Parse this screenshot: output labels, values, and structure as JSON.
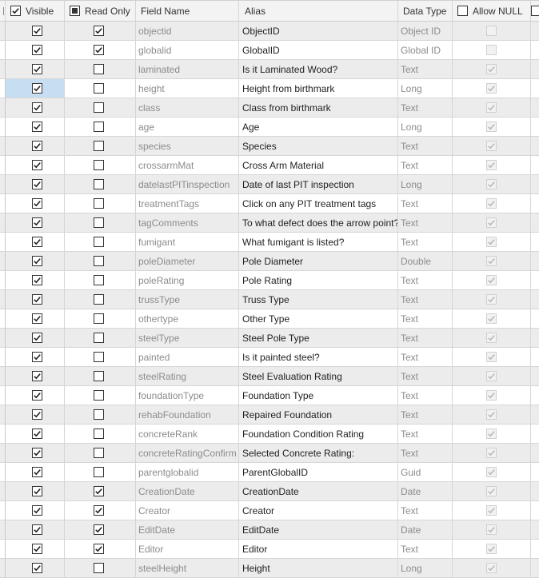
{
  "header": {
    "visible_label": "Visible",
    "readonly_label": "Read Only",
    "fieldname_label": "Field Name",
    "alias_label": "Alias",
    "datatype_label": "Data Type",
    "allownull_label": "Allow NULL"
  },
  "rows": [
    {
      "name": "objectid",
      "alias": "ObjectID",
      "type": "Object ID",
      "visible": true,
      "readonly": true,
      "allownull": false
    },
    {
      "name": "globalid",
      "alias": "GlobalID",
      "type": "Global ID",
      "visible": true,
      "readonly": true,
      "allownull": false
    },
    {
      "name": "laminated",
      "alias": "Is it Laminated Wood?",
      "type": "Text",
      "visible": true,
      "readonly": false,
      "allownull": true
    },
    {
      "name": "height",
      "alias": "Height from birthmark",
      "type": "Long",
      "visible": true,
      "readonly": false,
      "allownull": true
    },
    {
      "name": "class",
      "alias": "Class from birthmark",
      "type": "Text",
      "visible": true,
      "readonly": false,
      "allownull": true
    },
    {
      "name": "age",
      "alias": "Age",
      "type": "Long",
      "visible": true,
      "readonly": false,
      "allownull": true
    },
    {
      "name": "species",
      "alias": "Species",
      "type": "Text",
      "visible": true,
      "readonly": false,
      "allownull": true
    },
    {
      "name": "crossarmMat",
      "alias": "Cross Arm Material",
      "type": "Text",
      "visible": true,
      "readonly": false,
      "allownull": true
    },
    {
      "name": "datelastPITinspection",
      "alias": "Date of last PIT inspection",
      "type": "Long",
      "visible": true,
      "readonly": false,
      "allownull": true
    },
    {
      "name": "treatmentTags",
      "alias": "Click on any PIT treatment tags",
      "type": "Text",
      "visible": true,
      "readonly": false,
      "allownull": true
    },
    {
      "name": "tagComments",
      "alias": "To what defect does the arrow point?",
      "type": "Text",
      "visible": true,
      "readonly": false,
      "allownull": true
    },
    {
      "name": "fumigant",
      "alias": "What fumigant is listed?",
      "type": "Text",
      "visible": true,
      "readonly": false,
      "allownull": true
    },
    {
      "name": "poleDiameter",
      "alias": "Pole Diameter",
      "type": "Double",
      "visible": true,
      "readonly": false,
      "allownull": true
    },
    {
      "name": "poleRating",
      "alias": "Pole Rating",
      "type": "Text",
      "visible": true,
      "readonly": false,
      "allownull": true
    },
    {
      "name": "trussType",
      "alias": "Truss Type",
      "type": "Text",
      "visible": true,
      "readonly": false,
      "allownull": true
    },
    {
      "name": "othertype",
      "alias": "Other Type",
      "type": "Text",
      "visible": true,
      "readonly": false,
      "allownull": true
    },
    {
      "name": "steelType",
      "alias": "Steel Pole Type",
      "type": "Text",
      "visible": true,
      "readonly": false,
      "allownull": true
    },
    {
      "name": "painted",
      "alias": "Is it painted steel?",
      "type": "Text",
      "visible": true,
      "readonly": false,
      "allownull": true
    },
    {
      "name": "steelRating",
      "alias": "Steel Evaluation Rating",
      "type": "Text",
      "visible": true,
      "readonly": false,
      "allownull": true
    },
    {
      "name": "foundationType",
      "alias": "Foundation Type",
      "type": "Text",
      "visible": true,
      "readonly": false,
      "allownull": true
    },
    {
      "name": "rehabFoundation",
      "alias": "Repaired Foundation",
      "type": "Text",
      "visible": true,
      "readonly": false,
      "allownull": true
    },
    {
      "name": "concreteRank",
      "alias": "Foundation Condition Rating",
      "type": "Text",
      "visible": true,
      "readonly": false,
      "allownull": true
    },
    {
      "name": "concreteRatingConfirm",
      "alias": "Selected Concrete Rating:",
      "type": "Text",
      "visible": true,
      "readonly": false,
      "allownull": true
    },
    {
      "name": "parentglobalid",
      "alias": "ParentGlobalID",
      "type": "Guid",
      "visible": true,
      "readonly": false,
      "allownull": true
    },
    {
      "name": "CreationDate",
      "alias": "CreationDate",
      "type": "Date",
      "visible": true,
      "readonly": true,
      "allownull": true
    },
    {
      "name": "Creator",
      "alias": "Creator",
      "type": "Text",
      "visible": true,
      "readonly": true,
      "allownull": true
    },
    {
      "name": "EditDate",
      "alias": "EditDate",
      "type": "Date",
      "visible": true,
      "readonly": true,
      "allownull": true
    },
    {
      "name": "Editor",
      "alias": "Editor",
      "type": "Text",
      "visible": true,
      "readonly": true,
      "allownull": true
    },
    {
      "name": "steelHeight",
      "alias": "Height",
      "type": "Long",
      "visible": true,
      "readonly": false,
      "allownull": true
    }
  ],
  "selected_row": 3,
  "colors": {
    "selection": "#c7def2",
    "alt_row": "#ececec",
    "grid_line": "#d6d6d6"
  }
}
